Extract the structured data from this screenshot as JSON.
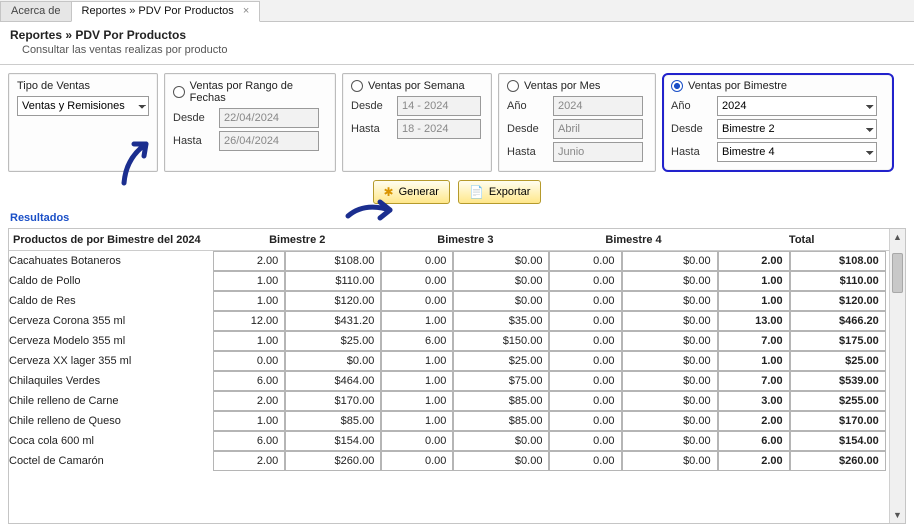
{
  "tabs": [
    {
      "label": "Acerca de",
      "active": false,
      "closable": false
    },
    {
      "label": "Reportes » PDV Por Productos",
      "active": true,
      "closable": true
    }
  ],
  "header": {
    "title": "Reportes » PDV Por Productos",
    "subtitle": "Consultar las ventas realizas por producto"
  },
  "filters": {
    "tipo": {
      "label": "Tipo de Ventas",
      "value": "Ventas y Remisiones"
    },
    "rangoFechas": {
      "title": "Ventas por Rango de Fechas",
      "selected": false,
      "desdeLabel": "Desde",
      "desdeValue": "22/04/2024",
      "hastaLabel": "Hasta",
      "hastaValue": "26/04/2024"
    },
    "semana": {
      "title": "Ventas por Semana",
      "selected": false,
      "desdeLabel": "Desde",
      "desdeValue": "14 - 2024",
      "hastaLabel": "Hasta",
      "hastaValue": "18 - 2024"
    },
    "mes": {
      "title": "Ventas por Mes",
      "selected": false,
      "anoLabel": "Año",
      "anoValue": "2024",
      "desdeLabel": "Desde",
      "desdeValue": "Abril",
      "hastaLabel": "Hasta",
      "hastaValue": "Junio"
    },
    "bimestre": {
      "title": "Ventas por Bimestre",
      "selected": true,
      "anoLabel": "Año",
      "anoValue": "2024",
      "desdeLabel": "Desde",
      "desdeValue": "Bimestre 2",
      "hastaLabel": "Hasta",
      "hastaValue": "Bimestre 4"
    }
  },
  "actions": {
    "generar": "Generar",
    "exportar": "Exportar"
  },
  "results": {
    "sectionLabel": "Resultados",
    "heading": "Productos de  por Bimestre del 2024",
    "periods": [
      "Bimestre 2",
      "Bimestre 3",
      "Bimestre 4",
      "Total"
    ],
    "rows": [
      {
        "name": "Cacahuates Botaneros",
        "p": [
          [
            "2.00",
            "$108.00"
          ],
          [
            "0.00",
            "$0.00"
          ],
          [
            "0.00",
            "$0.00"
          ]
        ],
        "t": [
          "2.00",
          "$108.00"
        ]
      },
      {
        "name": "Caldo de Pollo",
        "p": [
          [
            "1.00",
            "$110.00"
          ],
          [
            "0.00",
            "$0.00"
          ],
          [
            "0.00",
            "$0.00"
          ]
        ],
        "t": [
          "1.00",
          "$110.00"
        ]
      },
      {
        "name": "Caldo de Res",
        "p": [
          [
            "1.00",
            "$120.00"
          ],
          [
            "0.00",
            "$0.00"
          ],
          [
            "0.00",
            "$0.00"
          ]
        ],
        "t": [
          "1.00",
          "$120.00"
        ]
      },
      {
        "name": "Cerveza Corona 355 ml",
        "p": [
          [
            "12.00",
            "$431.20"
          ],
          [
            "1.00",
            "$35.00"
          ],
          [
            "0.00",
            "$0.00"
          ]
        ],
        "t": [
          "13.00",
          "$466.20"
        ]
      },
      {
        "name": "Cerveza Modelo 355 ml",
        "p": [
          [
            "1.00",
            "$25.00"
          ],
          [
            "6.00",
            "$150.00"
          ],
          [
            "0.00",
            "$0.00"
          ]
        ],
        "t": [
          "7.00",
          "$175.00"
        ]
      },
      {
        "name": "Cerveza XX lager 355 ml",
        "p": [
          [
            "0.00",
            "$0.00"
          ],
          [
            "1.00",
            "$25.00"
          ],
          [
            "0.00",
            "$0.00"
          ]
        ],
        "t": [
          "1.00",
          "$25.00"
        ]
      },
      {
        "name": "Chilaquiles Verdes",
        "p": [
          [
            "6.00",
            "$464.00"
          ],
          [
            "1.00",
            "$75.00"
          ],
          [
            "0.00",
            "$0.00"
          ]
        ],
        "t": [
          "7.00",
          "$539.00"
        ]
      },
      {
        "name": "Chile relleno de Carne",
        "p": [
          [
            "2.00",
            "$170.00"
          ],
          [
            "1.00",
            "$85.00"
          ],
          [
            "0.00",
            "$0.00"
          ]
        ],
        "t": [
          "3.00",
          "$255.00"
        ]
      },
      {
        "name": "Chile relleno de Queso",
        "p": [
          [
            "1.00",
            "$85.00"
          ],
          [
            "1.00",
            "$85.00"
          ],
          [
            "0.00",
            "$0.00"
          ]
        ],
        "t": [
          "2.00",
          "$170.00"
        ]
      },
      {
        "name": "Coca cola 600 ml",
        "p": [
          [
            "6.00",
            "$154.00"
          ],
          [
            "0.00",
            "$0.00"
          ],
          [
            "0.00",
            "$0.00"
          ]
        ],
        "t": [
          "6.00",
          "$154.00"
        ]
      },
      {
        "name": "Coctel de Camarón",
        "p": [
          [
            "2.00",
            "$260.00"
          ],
          [
            "0.00",
            "$0.00"
          ],
          [
            "0.00",
            "$0.00"
          ]
        ],
        "t": [
          "2.00",
          "$260.00"
        ]
      }
    ]
  },
  "icons": {
    "generar": "✱",
    "exportar": "📄"
  }
}
